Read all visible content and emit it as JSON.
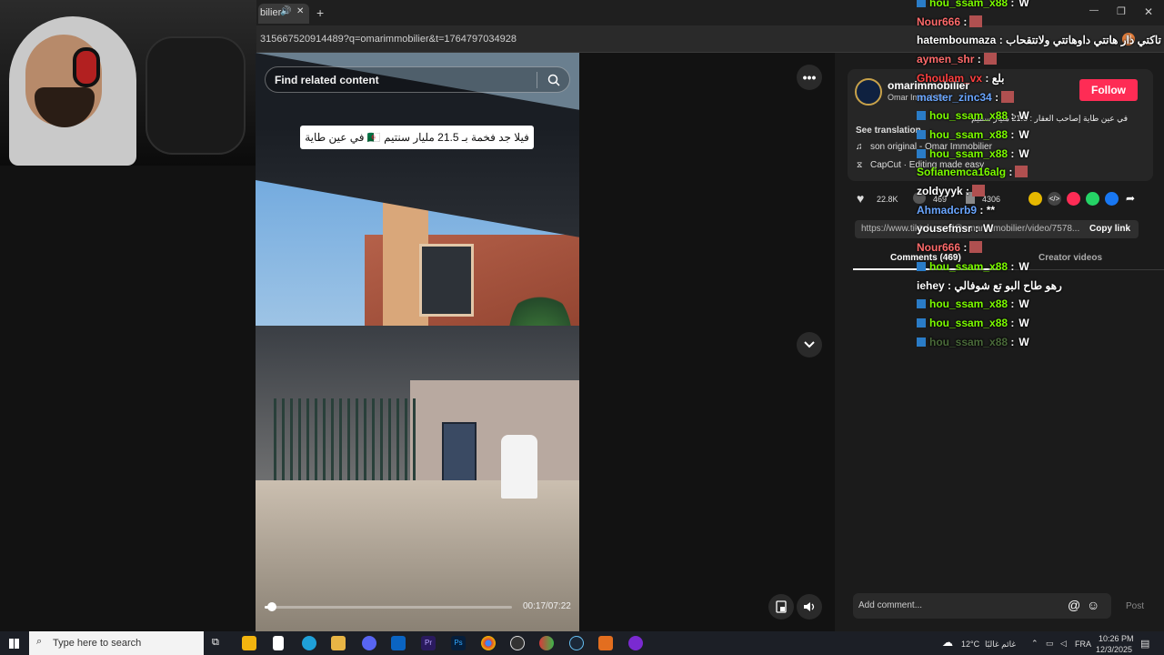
{
  "browser": {
    "tab_title": "bilier",
    "url": "315667520914489?q=omarimmobilier&t=1764797034928",
    "buttons": {
      "add_tab": "+",
      "minimize": "—",
      "restore": "❐",
      "close": "✕",
      "menu": "⋮"
    }
  },
  "video": {
    "search_placeholder": "Find related content",
    "caption": "فيلا جد فخمة بـ 21.5 مليار سنتيم 🇩🇿 في عين طاية",
    "time": "00:17/07:22",
    "progress": 0.04
  },
  "post": {
    "author": "omarimmobilier",
    "author_sub": "Omar Immobilier",
    "follow_label": "Follow",
    "description": "في عين طاية إصاحب العقار : 21.5 مليار سنتيم",
    "see_translation": "See translation",
    "sound": "son original - Omar Immobilier",
    "capcut": "CapCut · Editing made easy",
    "likes": "22.8K",
    "comments_count": "469",
    "saves": "4306",
    "link": "https://www.tiktok.com/@omarimmobilier/video/7578...",
    "copy_link": "Copy link",
    "tab_comments": "Comments (469)",
    "tab_creator": "Creator videos",
    "add_comment": "Add comment...",
    "post_button": "Post"
  },
  "chat": [
    {
      "user": "hou_ssam_x88",
      "color": "#7cfc00",
      "msg": ":",
      "badge": true,
      "emote": "W"
    },
    {
      "user": "Nour666",
      "color": "#ff6b6b",
      "msg": ":",
      "badge": false,
      "emote": "img"
    },
    {
      "user": "hatemboumaza",
      "color": "#ffffff",
      "msg": ": تاكتي دار هاتتي داوهاتتي ولاتتقحاب",
      "badge": false,
      "emote": ""
    },
    {
      "user": "aymen_shr",
      "color": "#ff6b6b",
      "msg": ":",
      "badge": false,
      "emote": "img"
    },
    {
      "user": "Ghoulam_vx",
      "color": "#ff4040",
      "msg": ": بلع",
      "badge": false,
      "emote": ""
    },
    {
      "user": "master_zinc34",
      "color": "#6aa6ff",
      "msg": ":",
      "badge": false,
      "emote": "img"
    },
    {
      "user": "hou_ssam_x88",
      "color": "#7cfc00",
      "msg": ":",
      "badge": true,
      "emote": "W"
    },
    {
      "user": "hou_ssam_x88",
      "color": "#7cfc00",
      "msg": ":",
      "badge": true,
      "emote": "W"
    },
    {
      "user": "hou_ssam_x88",
      "color": "#7cfc00",
      "msg": ":",
      "badge": true,
      "emote": "W"
    },
    {
      "user": "Sofianemca16alg",
      "color": "#7cfc00",
      "msg": ":",
      "badge": false,
      "emote": "img"
    },
    {
      "user": "zoldyyyk",
      "color": "#ffffff",
      "msg": ":",
      "badge": false,
      "emote": "img"
    },
    {
      "user": "Ahmadcrb9",
      "color": "#6aa6ff",
      "msg": ": **",
      "badge": false,
      "emote": ""
    },
    {
      "user": "yousefmsr",
      "color": "#ffffff",
      "msg": ":",
      "badge": false,
      "emote": "W"
    },
    {
      "user": "Nour666",
      "color": "#ff6b6b",
      "msg": ":",
      "badge": false,
      "emote": "img"
    },
    {
      "user": "hou_ssam_x88",
      "color": "#7cfc00",
      "msg": ":",
      "badge": true,
      "emote": "W"
    },
    {
      "user": "iehey",
      "color": "#ffffff",
      "msg": ": رهو طاح البو تع شوفالي",
      "badge": false,
      "emote": ""
    },
    {
      "user": "hou_ssam_x88",
      "color": "#7cfc00",
      "msg": ":",
      "badge": true,
      "emote": "W"
    },
    {
      "user": "hou_ssam_x88",
      "color": "#7cfc00",
      "msg": ":",
      "badge": true,
      "emote": "W"
    },
    {
      "user": "hou_ssam_x88",
      "color": "#4a6a3a",
      "msg": ":",
      "badge": true,
      "emote": "W"
    }
  ],
  "taskbar": {
    "search_placeholder": "Type here to search",
    "weather": "12°C",
    "weather_text": "غائم غالبًا",
    "lang": "FRA",
    "time": "10:26 PM",
    "date": "12/3/2025"
  }
}
